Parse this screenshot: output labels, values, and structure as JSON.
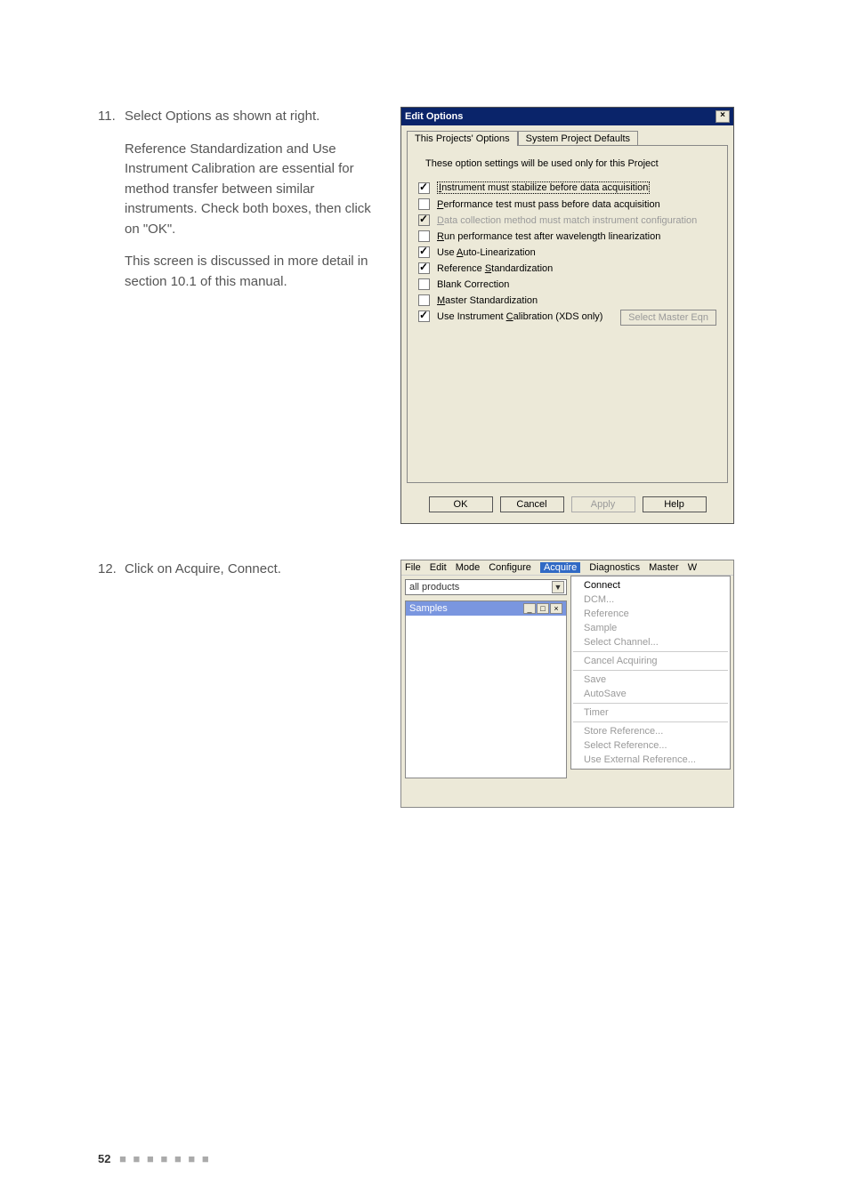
{
  "step11": {
    "num": "11.",
    "text1": "Select Options as shown at right.",
    "text2": "Reference Standardization and Use Instrument Calibration are essential for method transfer between similar instruments. Check both boxes, then click on \"OK\".",
    "text3": "This screen is discussed in more detail in section 10.1 of this manual."
  },
  "step12": {
    "num": "12.",
    "text1": "Click on Acquire, Connect."
  },
  "dialog": {
    "title": "Edit Options",
    "close": "×",
    "tabs": {
      "active": "This Projects' Options",
      "other": "System Project Defaults"
    },
    "intro": "These option settings will be used only for this Project",
    "options": [
      {
        "checked": true,
        "grey": false,
        "label": "Instrument must stabilize before data acquisition",
        "dim": false,
        "focus": true
      },
      {
        "checked": false,
        "grey": false,
        "label": "Performance test must pass before data acquisition",
        "dim": false
      },
      {
        "checked": true,
        "grey": true,
        "label": "Data collection method must match instrument configuration",
        "dim": true
      },
      {
        "checked": false,
        "grey": false,
        "label": "Run performance test after wavelength linearization",
        "dim": false
      },
      {
        "checked": true,
        "grey": false,
        "label": "Use Auto-Linearization",
        "dim": false
      },
      {
        "checked": true,
        "grey": false,
        "label": "Reference Standardization",
        "dim": false
      },
      {
        "checked": false,
        "grey": false,
        "label": "Blank Correction",
        "dim": false
      },
      {
        "checked": false,
        "grey": false,
        "label": "Master Standardization",
        "dim": false
      },
      {
        "checked": true,
        "grey": false,
        "label": "Use Instrument Calibration (XDS only)",
        "dim": false
      }
    ],
    "side_button": "Select Master Eqn",
    "buttons": {
      "ok": "OK",
      "cancel": "Cancel",
      "apply": "Apply",
      "help": "Help"
    }
  },
  "app": {
    "menubar": [
      "File",
      "Edit",
      "Mode",
      "Configure",
      "Acquire",
      "Diagnostics",
      "Master",
      "W"
    ],
    "active_menu_index": 4,
    "combo": "all products",
    "child_title": "Samples",
    "menu": {
      "group1": [
        {
          "label": "Connect",
          "enabled": true
        },
        {
          "label": "DCM...",
          "enabled": false
        },
        {
          "label": "Reference",
          "enabled": false
        },
        {
          "label": "Sample",
          "enabled": false
        },
        {
          "label": "Select Channel...",
          "enabled": false
        }
      ],
      "group2": [
        {
          "label": "Cancel Acquiring",
          "enabled": false
        }
      ],
      "group3": [
        {
          "label": "Save",
          "enabled": false
        },
        {
          "label": "AutoSave",
          "enabled": false
        }
      ],
      "group4": [
        {
          "label": "Timer",
          "enabled": false
        }
      ],
      "group5": [
        {
          "label": "Store Reference...",
          "enabled": false
        },
        {
          "label": "Select Reference...",
          "enabled": false
        },
        {
          "label": "Use External Reference...",
          "enabled": false
        }
      ]
    }
  },
  "footer": {
    "page": "52"
  }
}
